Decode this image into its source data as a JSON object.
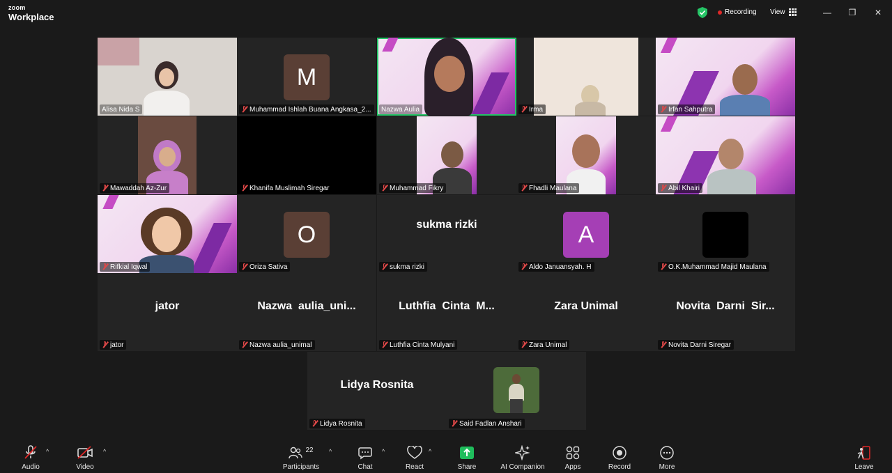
{
  "app": {
    "brand_small": "zoom",
    "brand_name": "Workplace"
  },
  "header": {
    "recording": "Recording",
    "view": "View"
  },
  "participants": [
    {
      "name": "Alisa Nida S",
      "muted": false,
      "type": "video"
    },
    {
      "name": "Muhammad Ishlah Buana Angkasa_2...",
      "muted": true,
      "type": "avatar",
      "letter": "M"
    },
    {
      "name": "Nazwa Aulia",
      "muted": false,
      "type": "video",
      "active": true
    },
    {
      "name": "Irma",
      "muted": true,
      "type": "video"
    },
    {
      "name": "Irfan Sahputra",
      "muted": true,
      "type": "video"
    },
    {
      "name": "Mawaddah Az-Zur",
      "muted": true,
      "type": "video"
    },
    {
      "name": "Khanifa Muslimah Siregar",
      "muted": true,
      "type": "black"
    },
    {
      "name": "Muhammad Fikry",
      "muted": true,
      "type": "video"
    },
    {
      "name": "Fhadli Maulana",
      "muted": true,
      "type": "video"
    },
    {
      "name": "Abil Khairi",
      "muted": true,
      "type": "video"
    },
    {
      "name": "Rifkial Iqwal",
      "muted": true,
      "type": "video"
    },
    {
      "name": "Oriza Sativa",
      "muted": true,
      "type": "avatar",
      "letter": "O"
    },
    {
      "name": "sukma rizki",
      "muted": true,
      "type": "name",
      "display": "sukma rizki"
    },
    {
      "name": "Aldo Januansyah. H",
      "muted": true,
      "type": "avatar",
      "letter": "A"
    },
    {
      "name": "O.K.Muhammad Majid Maulana",
      "muted": true,
      "type": "black-avatar"
    },
    {
      "name": "jator",
      "muted": true,
      "type": "name",
      "display": "jator"
    },
    {
      "name": "Nazwa aulia_unimal",
      "muted": true,
      "type": "name",
      "display": "Nazwa  aulia_uni..."
    },
    {
      "name": "Luthfia Cinta Mulyani",
      "muted": true,
      "type": "name",
      "display": "Luthfia  Cinta  M..."
    },
    {
      "name": "Zara Unimal",
      "muted": true,
      "type": "name",
      "display": "Zara Unimal"
    },
    {
      "name": "Novita Darni Siregar",
      "muted": true,
      "type": "name",
      "display": "Novita  Darni  Sir..."
    },
    {
      "name": "Lidya Rosnita",
      "muted": true,
      "type": "name",
      "display": "Lidya Rosnita"
    },
    {
      "name": "Said Fadlan Anshari",
      "muted": true,
      "type": "video"
    }
  ],
  "toolbar": {
    "audio": "Audio",
    "video": "Video",
    "participants": "Participants",
    "participants_count": "22",
    "chat": "Chat",
    "react": "React",
    "share": "Share",
    "ai": "AI Companion",
    "apps": "Apps",
    "record": "Record",
    "more": "More",
    "leave": "Leave"
  },
  "colors": {
    "active_border": "#25c466",
    "avatar_brown": "#5a3f35",
    "avatar_purple": "#a53fb5",
    "share_green": "#1fbd5c",
    "leave_red": "#e02828"
  }
}
